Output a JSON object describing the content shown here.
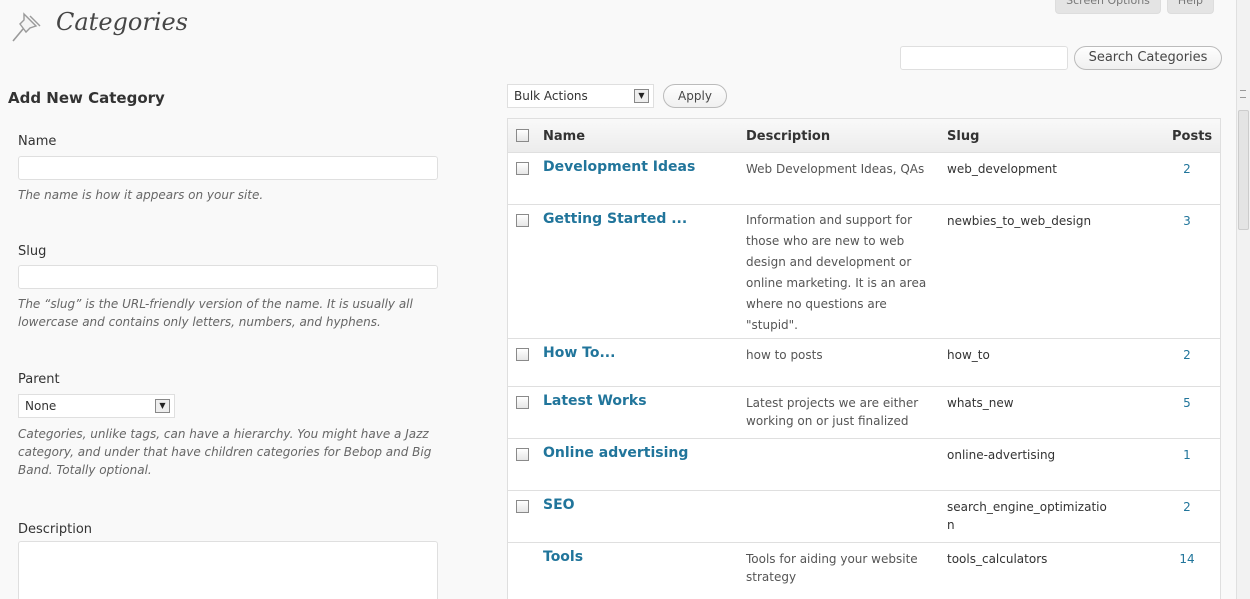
{
  "header": {
    "title": "Categories",
    "screen_options_label": "Screen Options",
    "help_label": "Help"
  },
  "search": {
    "value": "",
    "button_label": "Search Categories"
  },
  "form": {
    "section_title": "Add New Category",
    "name_label": "Name",
    "name_help": "The name is how it appears on your site.",
    "slug_label": "Slug",
    "slug_help": "The “slug” is the URL-friendly version of the name. It is usually all lowercase and contains only letters, numbers, and hyphens.",
    "parent_label": "Parent",
    "parent_selected": "None",
    "parent_help": "Categories, unlike tags, can have a hierarchy. You might have a Jazz category, and under that have children categories for Bebop and Big Band. Totally optional.",
    "description_label": "Description"
  },
  "bulk": {
    "selected": "Bulk Actions",
    "apply_label": "Apply"
  },
  "table": {
    "columns": {
      "name": "Name",
      "description": "Description",
      "slug": "Slug",
      "posts": "Posts"
    },
    "rows": [
      {
        "name": "Development Ideas",
        "description": "Web Development Ideas, QAs",
        "slug": "web_development",
        "posts": "2"
      },
      {
        "name": "Getting Started ...",
        "description": "Information and support for those who are new to web design and development or online marketing. It is an area where no questions are \"stupid\".",
        "slug": "newbies_to_web_design",
        "posts": "3"
      },
      {
        "name": "How To...",
        "description": "how to posts",
        "slug": "how_to",
        "posts": "2"
      },
      {
        "name": "Latest Works",
        "description": "Latest projects we are either working on or just finalized",
        "slug": "whats_new",
        "posts": "5"
      },
      {
        "name": "Online advertising",
        "description": "",
        "slug": "online-advertising",
        "posts": "1"
      },
      {
        "name": "SEO",
        "description": "",
        "slug": "search_engine_optimizatio\nn",
        "posts": "2"
      },
      {
        "name": "Tools",
        "description": "Tools for aiding your website strategy",
        "slug": "tools_calculators",
        "posts": "14"
      }
    ]
  },
  "colors": {
    "link": "#21759b",
    "border": "#dfdfdf",
    "background": "#f9f9f9"
  },
  "icons": {
    "page_icon": "pushpin-icon",
    "dropdown_icon": "dropdown-arrow-icon",
    "checkbox_icon": "checkbox"
  }
}
